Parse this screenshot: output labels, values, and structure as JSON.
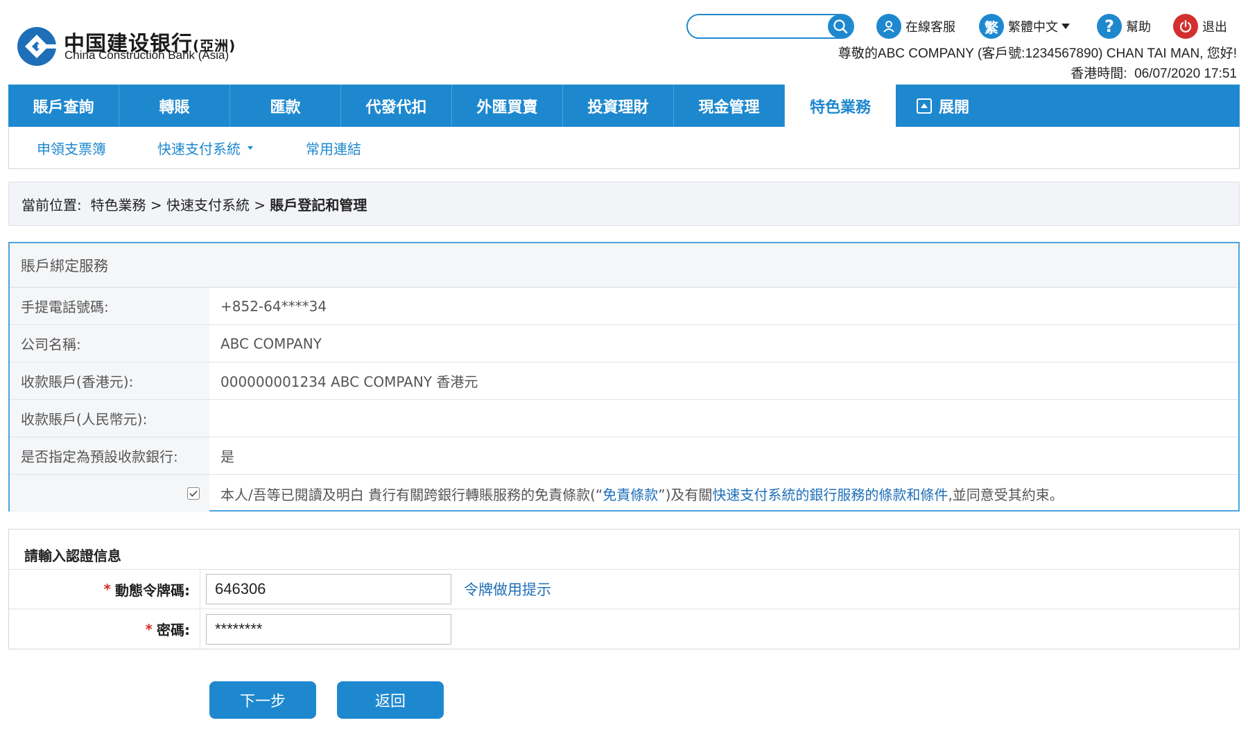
{
  "brand": {
    "name_cn": "中国建设银行",
    "name_cn_suffix": "(亞洲)",
    "name_en": "China Construction Bank (Asia)"
  },
  "header": {
    "search_placeholder": "",
    "service_label": "在線客服",
    "lang_icon_char": "繁",
    "lang_label": "繁體中文",
    "help_label": "幫助",
    "logout_label": "退出",
    "greeting": "尊敬的ABC COMPANY (客戶號:1234567890) CHAN TAI MAN, 您好!",
    "time_label": "香港時間:",
    "time_value": "06/07/2020 17:51"
  },
  "nav": {
    "items": [
      {
        "label": "賬戶查詢"
      },
      {
        "label": "轉賬"
      },
      {
        "label": "匯款"
      },
      {
        "label": "代發代扣"
      },
      {
        "label": "外匯買賣"
      },
      {
        "label": "投資理財"
      },
      {
        "label": "現金管理"
      },
      {
        "label": "特色業務"
      }
    ],
    "expand_label": "展開"
  },
  "subnav": {
    "items": [
      {
        "label": "申領支票簿"
      },
      {
        "label": "快速支付系統"
      },
      {
        "label": "常用連結"
      }
    ]
  },
  "breadcrumb": {
    "prefix": "當前位置:",
    "path": "特色業務 > 快速支付系統 >",
    "current": "賬戶登記和管理"
  },
  "binding": {
    "title": "賬戶綁定服務",
    "rows": [
      {
        "label": "手提電話號碼:",
        "value": "+852-64****34"
      },
      {
        "label": "公司名稱:",
        "value": "ABC COMPANY"
      },
      {
        "label": "收款賬戶(香港元):",
        "value": "000000001234 ABC COMPANY 香港元"
      },
      {
        "label": "收款賬戶(人民幣元):",
        "value": ""
      },
      {
        "label": "是否指定為預設收款銀行:",
        "value": "是"
      }
    ],
    "agreement_part1": "本人/吾等已閱讀及明白 貴行有關跨銀行轉賬服務的免責條款(“",
    "agreement_link1": "免責條款",
    "agreement_part2": "”)及有關",
    "agreement_link2": "快速支付系統的銀行服務的條款和條件",
    "agreement_part3": ",並同意受其約束。",
    "agreement_checked": true
  },
  "auth": {
    "title": "請輸入認證信息",
    "token_label": "動態令牌碼:",
    "token_value": "646306",
    "token_help": "令牌做用提示",
    "password_label": "密碼:",
    "password_value": "********",
    "required_mark": "*"
  },
  "buttons": {
    "next": "下一步",
    "back": "返回"
  },
  "colors": {
    "primary": "#1e88cf",
    "logout_red": "#d32f2f"
  }
}
